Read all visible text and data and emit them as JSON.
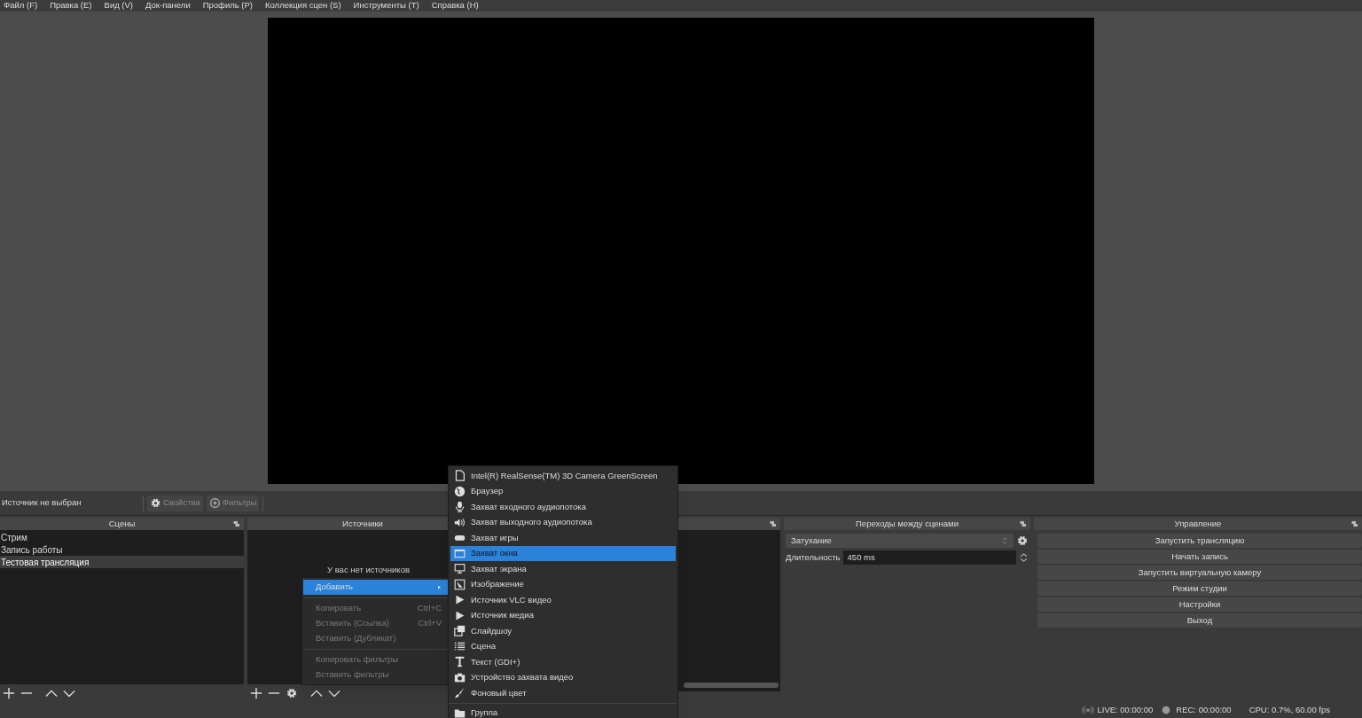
{
  "menu_bar": [
    "Файл (F)",
    "Правка (E)",
    "Вид (V)",
    "Док-панели",
    "Профиль (P)",
    "Коллекция сцен (S)",
    "Инструменты (T)",
    "Справка (H)"
  ],
  "source_toolbar": {
    "label": "Источник не выбран",
    "buttons": [
      {
        "label": "Свойства",
        "disabled": true
      },
      {
        "label": "Фильтры",
        "disabled": true
      }
    ]
  },
  "scenes": {
    "title": "Сцены",
    "items": [
      {
        "label": "Стрим",
        "selected": false
      },
      {
        "label": "Запись работы",
        "selected": false
      },
      {
        "label": "Тестовая трансляция",
        "selected": true
      }
    ]
  },
  "sources": {
    "title": "Источники",
    "empty_text": "У вас нет источников"
  },
  "transitions": {
    "title": "Переходы между сценами",
    "transition": "Затухание",
    "duration_label": "Длительность",
    "duration": "450 ms"
  },
  "controls": {
    "title": "Управление",
    "buttons": [
      "Запустить трансляцию",
      "Начать запись",
      "Запустить виртуальную камеру",
      "Режим студии",
      "Настройки",
      "Выход"
    ]
  },
  "context_menu": {
    "items": [
      {
        "kind": "item",
        "label": "Добавить",
        "disabled": false,
        "selected": true,
        "submenu": true
      },
      {
        "kind": "separator"
      },
      {
        "kind": "item",
        "label": "Копировать",
        "shortcut": "Ctrl+C",
        "disabled": true,
        "selected": false,
        "submenu": false
      },
      {
        "kind": "item",
        "label": "Вставить (Ссылка)",
        "shortcut": "Ctrl+V",
        "disabled": true,
        "selected": false,
        "submenu": false
      },
      {
        "kind": "item",
        "label": "Вставить (Дубликат)",
        "disabled": true,
        "selected": false,
        "submenu": false
      },
      {
        "kind": "separator"
      },
      {
        "kind": "item",
        "label": "Копировать фильтры",
        "disabled": true,
        "selected": false,
        "submenu": false
      },
      {
        "kind": "item",
        "label": "Вставить фильтры",
        "disabled": true,
        "selected": false,
        "submenu": false
      }
    ]
  },
  "add_submenu": {
    "items": [
      {
        "kind": "item",
        "label": "Intel(R) RealSense(TM) 3D Camera GreenScreen",
        "selected": false
      },
      {
        "kind": "item",
        "label": "Браузер",
        "selected": false
      },
      {
        "kind": "item",
        "label": "Захват входного аудиопотока",
        "selected": false
      },
      {
        "kind": "item",
        "label": "Захват выходного аудиопотока",
        "selected": false
      },
      {
        "kind": "item",
        "label": "Захват игры",
        "selected": false
      },
      {
        "kind": "item",
        "label": "Захват окна",
        "selected": true
      },
      {
        "kind": "item",
        "label": "Захват экрана",
        "selected": false
      },
      {
        "kind": "item",
        "label": "Изображение",
        "selected": false
      },
      {
        "kind": "item",
        "label": "Источник VLC видео",
        "selected": false
      },
      {
        "kind": "item",
        "label": "Источник медиа",
        "selected": false
      },
      {
        "kind": "item",
        "label": "Слайдшоу",
        "selected": false
      },
      {
        "kind": "item",
        "label": "Сцена",
        "selected": false
      },
      {
        "kind": "item",
        "label": "Текст (GDI+)",
        "selected": false
      },
      {
        "kind": "item",
        "label": "Устройство захвата видео",
        "selected": false
      },
      {
        "kind": "item",
        "label": "Фоновый цвет",
        "selected": false
      },
      {
        "kind": "separator"
      },
      {
        "kind": "item",
        "label": "Группа",
        "selected": false
      }
    ]
  },
  "status_bar": {
    "live": "LIVE: 00:00:00",
    "rec": "REC: 00:00:00",
    "cpu": "CPU: 0.7%, 60.00 fps"
  }
}
